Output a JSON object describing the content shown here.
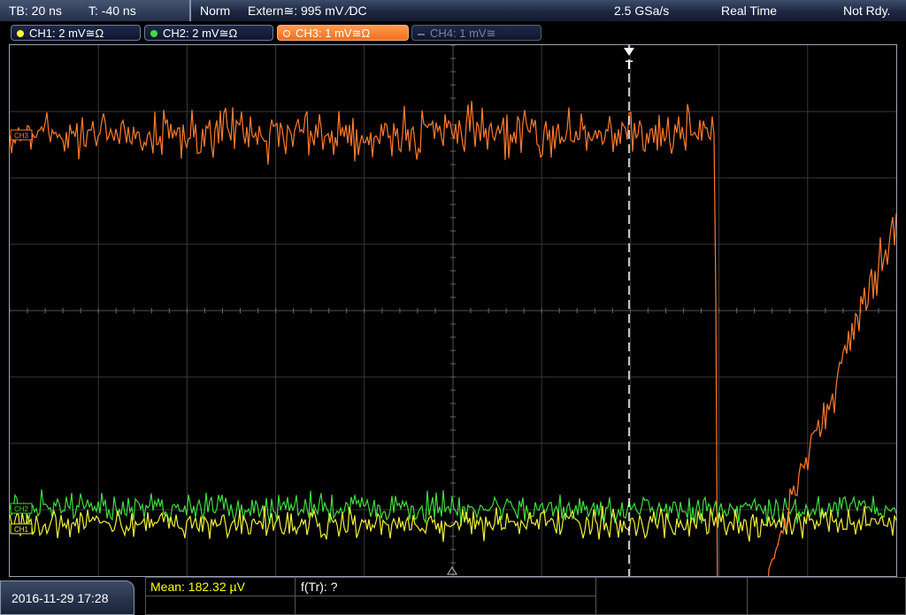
{
  "status_bar": {
    "timebase": "TB: 20 ns",
    "trigger_time": "T: -40 ns",
    "trigger_mode": "Norm",
    "trigger_source": "Extern≅: 995 mV ∕DC",
    "sample_rate": "2.5 GSa/s",
    "acq_mode": "Real Time",
    "run_status": "Not Rdy."
  },
  "channels": [
    {
      "label": "CH1: 2 mV≅Ω",
      "color": "#ffff3a",
      "active": false,
      "enabled": true
    },
    {
      "label": "CH2: 2 mV≅Ω",
      "color": "#40e040",
      "active": false,
      "enabled": true
    },
    {
      "label": "CH3: 1 mV≅Ω",
      "color": "#ff8a3a",
      "active": true,
      "enabled": true
    },
    {
      "label": "CH4: 1 mV≅",
      "color": "#707480",
      "active": false,
      "enabled": false
    }
  ],
  "markers": {
    "trigger_label": "T",
    "ch3_marker": "CH3",
    "ch2_marker": "CH2",
    "ch1_marker": "CH1"
  },
  "bottom_bar": {
    "datetime": "2016-11-29 17:28",
    "measurement_mean": "Mean: 182.32 µV",
    "measurement_freq": "f(Tr): ?"
  },
  "colors": {
    "ch1": "#f2f23a",
    "ch2": "#3fdc3f",
    "ch3": "#ff7b2e",
    "grid": "#3a3a3a",
    "measurement_text": "#ffff00"
  }
}
